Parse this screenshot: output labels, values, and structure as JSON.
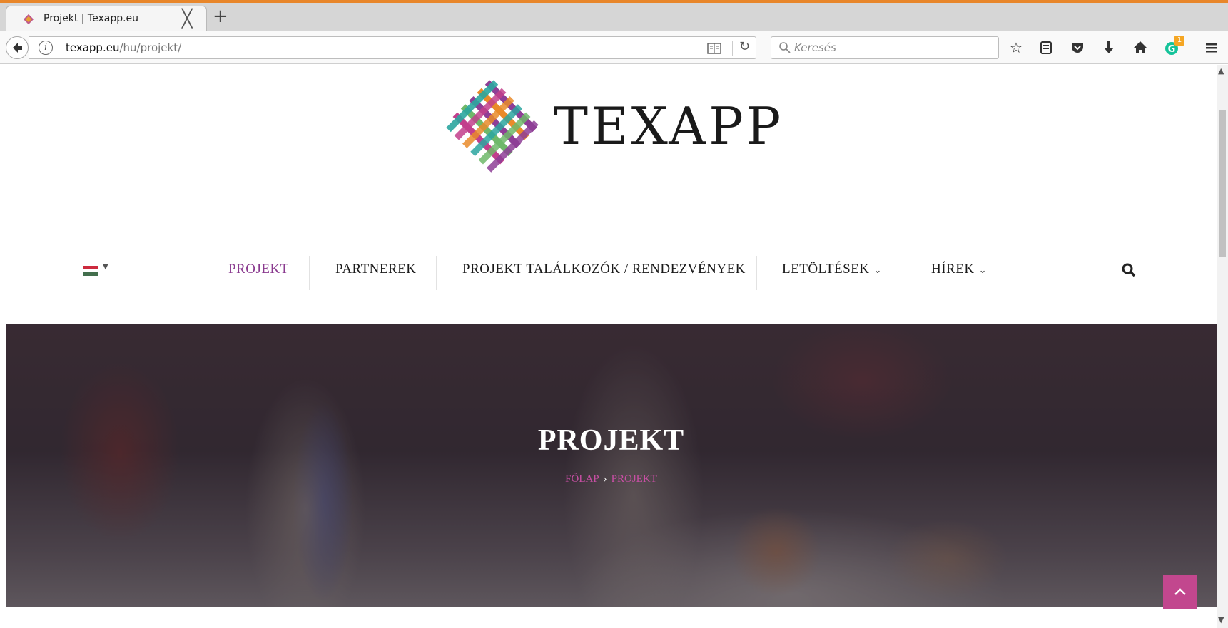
{
  "browser": {
    "tab_title": "Projekt | Texapp.eu",
    "tab_close": "╳",
    "new_tab": "+",
    "url_host": "texapp.eu",
    "url_path": "/hu/projekt/",
    "search_placeholder": "Keresés",
    "extension_badge": "1",
    "accent_color": "#e8862a"
  },
  "site": {
    "logo_text": "TEXAPP",
    "brand_color": "#8a3a8f",
    "language_flag": "hungary-flag",
    "menu": [
      {
        "label": "PROJEKT",
        "active": true
      },
      {
        "label": "PARTNEREK",
        "active": false
      },
      {
        "label": "PROJEKT TALÁLKOZÓK / RENDEZVÉNYEK",
        "active": false
      },
      {
        "label": "LETÖLTÉSEK",
        "active": false,
        "dropdown": true
      },
      {
        "label": "HÍREK",
        "active": false,
        "dropdown": true
      }
    ],
    "chevron": "⌄"
  },
  "hero": {
    "title": "PROJEKT",
    "breadcrumb_home": "FŐLAP",
    "breadcrumb_sep": "›",
    "breadcrumb_current": "PROJEKT",
    "breadcrumb_color": "#c94fa5"
  },
  "back_to_top_color": "#c2478e"
}
